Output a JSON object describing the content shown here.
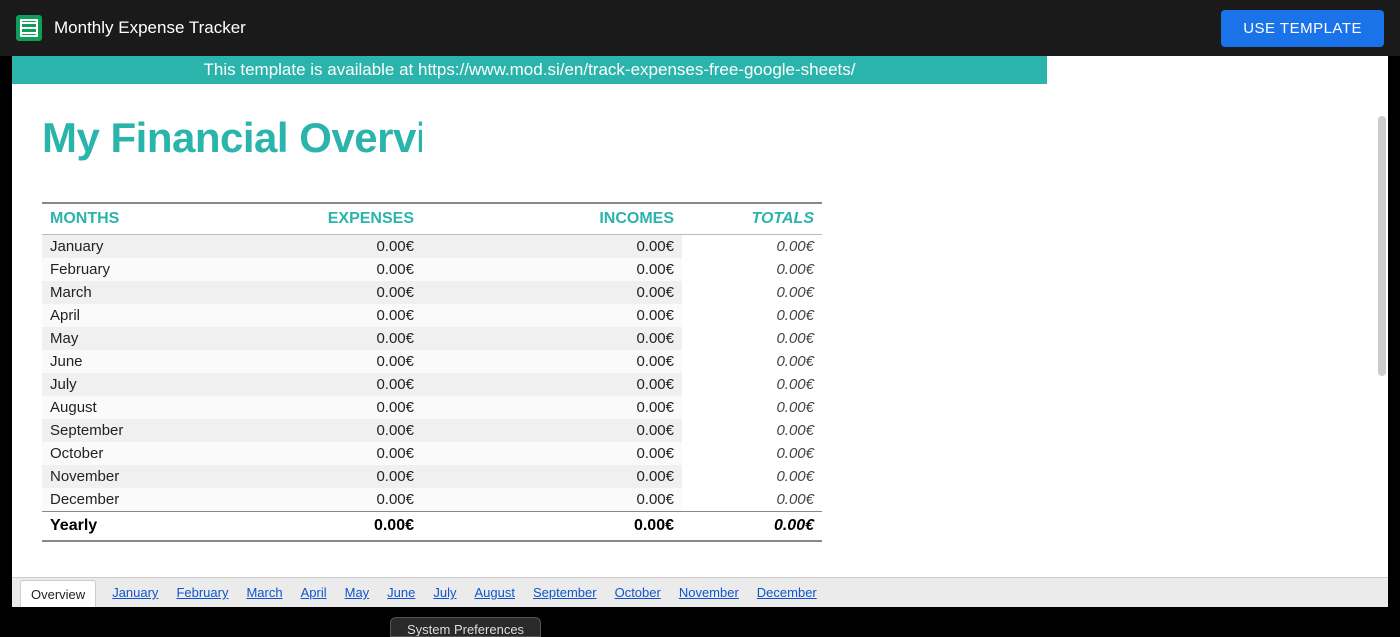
{
  "topbar": {
    "title": "Monthly Expense Tracker",
    "use_template": "USE TEMPLATE"
  },
  "banner": "This template is available at https://www.mod.si/en/track-expenses-free-google-sheets/",
  "heading": "My Financial Overview",
  "table": {
    "headers": {
      "months": "MONTHS",
      "expenses": "EXPENSES",
      "incomes": "INCOMES",
      "totals": "TOTALS"
    },
    "rows": [
      {
        "month": "January",
        "exp": "0.00€",
        "inc": "0.00€",
        "tot": "0.00€"
      },
      {
        "month": "February",
        "exp": "0.00€",
        "inc": "0.00€",
        "tot": "0.00€"
      },
      {
        "month": "March",
        "exp": "0.00€",
        "inc": "0.00€",
        "tot": "0.00€"
      },
      {
        "month": "April",
        "exp": "0.00€",
        "inc": "0.00€",
        "tot": "0.00€"
      },
      {
        "month": "May",
        "exp": "0.00€",
        "inc": "0.00€",
        "tot": "0.00€"
      },
      {
        "month": "June",
        "exp": "0.00€",
        "inc": "0.00€",
        "tot": "0.00€"
      },
      {
        "month": "July",
        "exp": "0.00€",
        "inc": "0.00€",
        "tot": "0.00€"
      },
      {
        "month": "August",
        "exp": "0.00€",
        "inc": "0.00€",
        "tot": "0.00€"
      },
      {
        "month": "September",
        "exp": "0.00€",
        "inc": "0.00€",
        "tot": "0.00€"
      },
      {
        "month": "October",
        "exp": "0.00€",
        "inc": "0.00€",
        "tot": "0.00€"
      },
      {
        "month": "November",
        "exp": "0.00€",
        "inc": "0.00€",
        "tot": "0.00€"
      },
      {
        "month": "December",
        "exp": "0.00€",
        "inc": "0.00€",
        "tot": "0.00€"
      }
    ],
    "yearly": {
      "label": "Yearly",
      "exp": "0.00€",
      "inc": "0.00€",
      "tot": "0.00€"
    }
  },
  "tabs": {
    "active": "Overview",
    "links": [
      "January",
      "February",
      "March",
      "April",
      "May",
      "June",
      "July",
      "August",
      "September",
      "October",
      "November",
      "December"
    ]
  },
  "bottom_widget": "System Preferences"
}
